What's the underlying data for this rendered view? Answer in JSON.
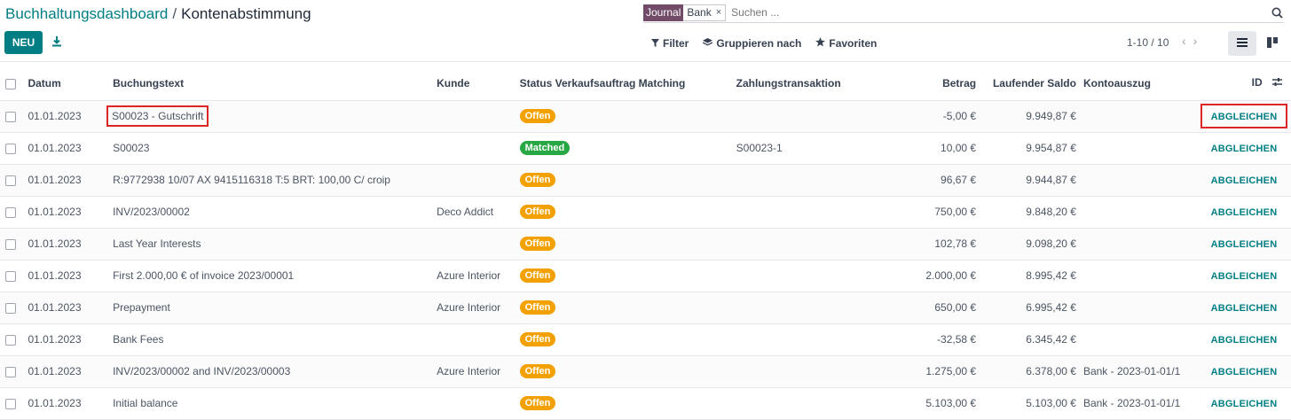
{
  "breadcrumb": {
    "parent": "Buchhaltungsdashboard",
    "separator": "/",
    "current": "Kontenabstimmung"
  },
  "toolbar": {
    "new_label": "NEU"
  },
  "search": {
    "facet_category": "Journal",
    "facet_value": "Bank",
    "facet_remove": "×",
    "placeholder": "Suchen ..."
  },
  "filters": {
    "filter_label": "Filter",
    "group_label": "Gruppieren nach",
    "favorites_label": "Favoriten"
  },
  "pager": {
    "text": "1-10 / 10"
  },
  "table": {
    "headers": {
      "date": "Datum",
      "text": "Buchungstext",
      "customer": "Kunde",
      "status": "Status Verkaufsauftrag Matching",
      "transaction": "Zahlungstransaktion",
      "amount": "Betrag",
      "balance": "Laufender Saldo",
      "statement": "Kontoauszug",
      "id": "ID"
    },
    "action_label": "ABGLEICHEN",
    "rows": [
      {
        "date": "01.01.2023",
        "text": "S00023 - Gutschrift",
        "customer": "",
        "status": "Offen",
        "transaction": "",
        "amount": "-5,00 €",
        "balance": "9.949,87 €",
        "statement": ""
      },
      {
        "date": "01.01.2023",
        "text": "S00023",
        "customer": "",
        "status": "Matched",
        "transaction": "S00023-1",
        "amount": "10,00 €",
        "balance": "9.954,87 €",
        "statement": ""
      },
      {
        "date": "01.01.2023",
        "text": "R:9772938 10/07 AX 9415116318 T:5 BRT: 100,00 C/ croip",
        "customer": "",
        "status": "Offen",
        "transaction": "",
        "amount": "96,67 €",
        "balance": "9.944,87 €",
        "statement": ""
      },
      {
        "date": "01.01.2023",
        "text": "INV/2023/00002",
        "customer": "Deco Addict",
        "status": "Offen",
        "transaction": "",
        "amount": "750,00 €",
        "balance": "9.848,20 €",
        "statement": ""
      },
      {
        "date": "01.01.2023",
        "text": "Last Year Interests",
        "customer": "",
        "status": "Offen",
        "transaction": "",
        "amount": "102,78 €",
        "balance": "9.098,20 €",
        "statement": ""
      },
      {
        "date": "01.01.2023",
        "text": "First 2.000,00 € of invoice 2023/00001",
        "customer": "Azure Interior",
        "status": "Offen",
        "transaction": "",
        "amount": "2.000,00 €",
        "balance": "8.995,42 €",
        "statement": ""
      },
      {
        "date": "01.01.2023",
        "text": "Prepayment",
        "customer": "Azure Interior",
        "status": "Offen",
        "transaction": "",
        "amount": "650,00 €",
        "balance": "6.995,42 €",
        "statement": ""
      },
      {
        "date": "01.01.2023",
        "text": "Bank Fees",
        "customer": "",
        "status": "Offen",
        "transaction": "",
        "amount": "-32,58 €",
        "balance": "6.345,42 €",
        "statement": ""
      },
      {
        "date": "01.01.2023",
        "text": "INV/2023/00002 and INV/2023/00003",
        "customer": "Azure Interior",
        "status": "Offen",
        "transaction": "",
        "amount": "1.275,00 €",
        "balance": "6.378,00 €",
        "statement": "Bank - 2023-01-01/1"
      },
      {
        "date": "01.01.2023",
        "text": "Initial balance",
        "customer": "",
        "status": "Offen",
        "transaction": "",
        "amount": "5.103,00 €",
        "balance": "5.103,00 €",
        "statement": "Bank - 2023-01-01/1"
      }
    ]
  },
  "colors": {
    "brand": "#017e84",
    "journal_facet": "#714b67",
    "status_open": "#f2a100",
    "status_matched": "#28a745",
    "highlight": "#dc2626"
  }
}
